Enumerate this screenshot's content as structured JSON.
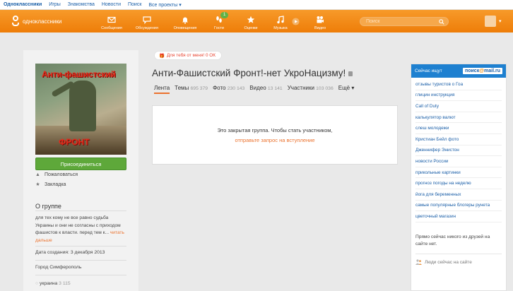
{
  "topbar": {
    "items": [
      "Одноклассники",
      "Игры",
      "Знакомства",
      "Новости",
      "Поиск",
      "Все проекты ▾"
    ]
  },
  "header": {
    "logo_text": "одноклассники",
    "nav": [
      {
        "label": "Сообщения",
        "icon": "envelope-icon"
      },
      {
        "label": "Обсуждения",
        "icon": "chat-icon"
      },
      {
        "label": "Оповещения",
        "icon": "bell-icon"
      },
      {
        "label": "Гости",
        "icon": "footprints-icon",
        "badge": "1"
      },
      {
        "label": "Оценки",
        "icon": "star-icon"
      },
      {
        "label": "Музыка",
        "icon": "music-icon"
      },
      {
        "label": "Видео",
        "icon": "camera-icon"
      }
    ],
    "search_placeholder": "Поиск"
  },
  "colors": {
    "brand_orange": "#ee7d08",
    "link_blue": "#1b5fa8",
    "join_green": "#5ea83a",
    "mail_blue": "#1e80d0"
  },
  "gift": {
    "text": "Для тебя от меня! 0 ОК"
  },
  "group": {
    "cover_text_top": "Анти-фашистский",
    "cover_text_bottom": "ФРОНТ",
    "title": "Анти-Фашистский Фронт!-нет УкроНацизму!",
    "join_label": "Присоединиться",
    "complain_label": "Пожаловаться",
    "bookmark_label": "Закладка",
    "tabs": [
      {
        "label": "Лента",
        "count": ""
      },
      {
        "label": "Темы",
        "count": "695 379"
      },
      {
        "label": "Фото",
        "count": "230 143"
      },
      {
        "label": "Видео",
        "count": "13 141"
      },
      {
        "label": "Участники",
        "count": "103 036"
      },
      {
        "label": "Ещё ▾",
        "count": ""
      }
    ],
    "closed_text": "Это закрытая группа. Чтобы стать участником,",
    "closed_link": "отправьте запрос на вступление"
  },
  "about": {
    "title": "О группе",
    "text": "для тех кому не все равно судьба Украины и они не согласны с приходом фашистов к власти. перед тем к...",
    "more_link": "читать дальше",
    "created": "Дата создания: 3 декабря 2013",
    "city": "Город Симферополь",
    "tag": "украина",
    "tag_count": "3 115"
  },
  "right": {
    "header_label": "Сейчас ищут",
    "mail_brand_a": "поиск",
    "mail_brand_at": "@",
    "mail_brand_b": "mail.ru",
    "searches": [
      "отзывы туристов о Гоа",
      "глицин инструкция",
      "Call of Duty",
      "калькулятор валют",
      "слеш молодежи",
      "Кристиан Бейл фото",
      "Дженнифер Энистон",
      "новости России",
      "прикольные картинки",
      "прогноз погоды на неделю",
      "йога для беременных",
      "самые популярные блогеры рунета",
      "цветочный магазин"
    ],
    "friends_text": "Прямо сейчас никого из друзей на сайте нет.",
    "online_label": "Люди сейчас на сайте"
  }
}
